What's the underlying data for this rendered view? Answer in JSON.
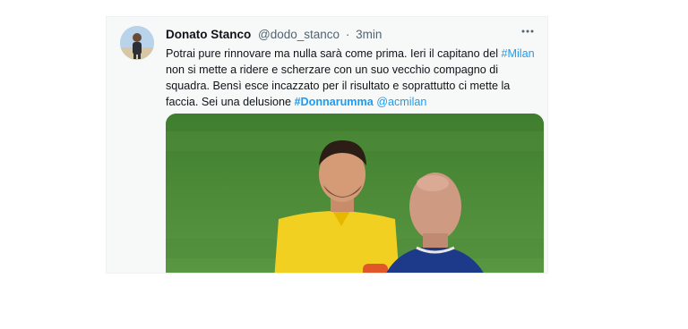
{
  "tweet": {
    "author_name": "Donato Stanco",
    "author_handle": "@dodo_stanco",
    "separator": "·",
    "time": "3min",
    "more_icon": "more-horizontal-icon",
    "text_1": "Potrai pure rinnovare ma nulla sarà come prima. Ieri il capitano del ",
    "hashtag_milan": "#Milan",
    "text_2": " non si mette a ridere e scherzare con un suo vecchio compagno di squadra. Bensì esce incazzato per il risultato e soprattutto ci mette la faccia. Sei una delusione ",
    "hashtag_donnarumma": "#Donnarumma",
    "text_space": " ",
    "mention_acmilan": "@acmilan"
  },
  "colors": {
    "link": "#1d9bf0",
    "card_background": "#f7f9f9",
    "pitch": "#4c8a37",
    "jersey_yellow": "#f2d021",
    "jersey_blue": "#1d3a8a"
  }
}
